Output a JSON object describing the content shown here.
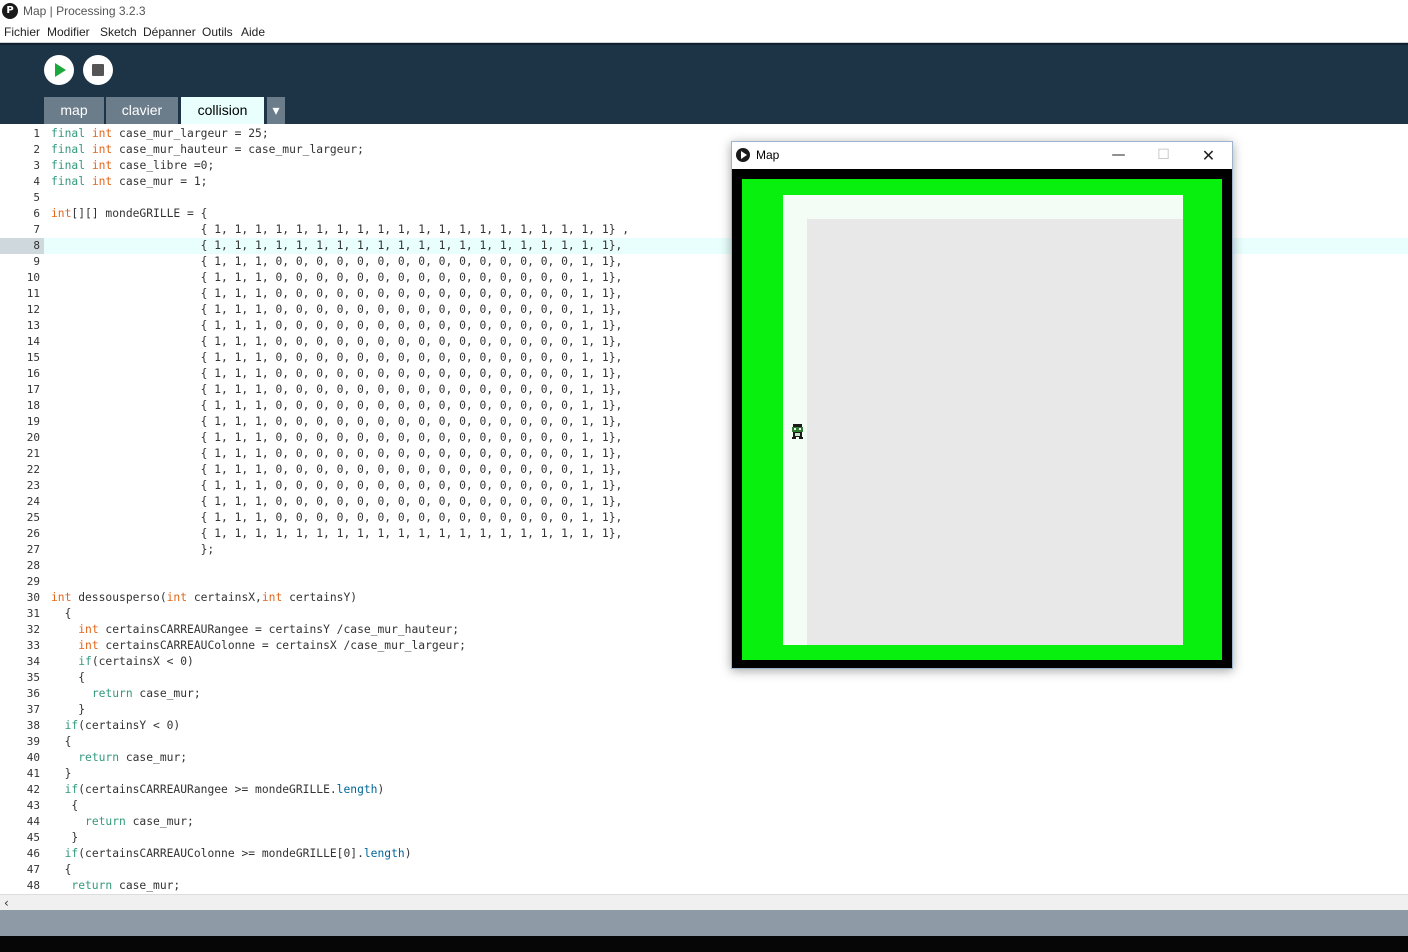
{
  "window": {
    "title": "Map | Processing 3.2.3",
    "app_icon": "P"
  },
  "menu": [
    "Fichier",
    "Modifier",
    "Sketch",
    "Dépanner",
    "Outils",
    "Aide"
  ],
  "tabs": [
    {
      "label": "map"
    },
    {
      "label": "clavier"
    },
    {
      "label": "collision",
      "active": true
    }
  ],
  "tab_dropdown": "▾",
  "editor": {
    "current_line": 8,
    "lines": [
      "final int case_mur_largeur = 25;",
      "final int case_mur_hauteur = case_mur_largeur;",
      "final int case_libre =0;",
      "final int case_mur = 1;",
      "",
      "int[][] mondeGRILLE = {",
      "                      { 1, 1, 1, 1, 1, 1, 1, 1, 1, 1, 1, 1, 1, 1, 1, 1, 1, 1, 1, 1} ,",
      "                      { 1, 1, 1, 1, 1, 1, 1, 1, 1, 1, 1, 1, 1, 1, 1, 1, 1, 1, 1, 1},",
      "                      { 1, 1, 1, 0, 0, 0, 0, 0, 0, 0, 0, 0, 0, 0, 0, 0, 0, 0, 1, 1},",
      "                      { 1, 1, 1, 0, 0, 0, 0, 0, 0, 0, 0, 0, 0, 0, 0, 0, 0, 0, 1, 1},",
      "                      { 1, 1, 1, 0, 0, 0, 0, 0, 0, 0, 0, 0, 0, 0, 0, 0, 0, 0, 1, 1},",
      "                      { 1, 1, 1, 0, 0, 0, 0, 0, 0, 0, 0, 0, 0, 0, 0, 0, 0, 0, 1, 1},",
      "                      { 1, 1, 1, 0, 0, 0, 0, 0, 0, 0, 0, 0, 0, 0, 0, 0, 0, 0, 1, 1},",
      "                      { 1, 1, 1, 0, 0, 0, 0, 0, 0, 0, 0, 0, 0, 0, 0, 0, 0, 0, 1, 1},",
      "                      { 1, 1, 1, 0, 0, 0, 0, 0, 0, 0, 0, 0, 0, 0, 0, 0, 0, 0, 1, 1},",
      "                      { 1, 1, 1, 0, 0, 0, 0, 0, 0, 0, 0, 0, 0, 0, 0, 0, 0, 0, 1, 1},",
      "                      { 1, 1, 1, 0, 0, 0, 0, 0, 0, 0, 0, 0, 0, 0, 0, 0, 0, 0, 1, 1},",
      "                      { 1, 1, 1, 0, 0, 0, 0, 0, 0, 0, 0, 0, 0, 0, 0, 0, 0, 0, 1, 1},",
      "                      { 1, 1, 1, 0, 0, 0, 0, 0, 0, 0, 0, 0, 0, 0, 0, 0, 0, 0, 1, 1},",
      "                      { 1, 1, 1, 0, 0, 0, 0, 0, 0, 0, 0, 0, 0, 0, 0, 0, 0, 0, 1, 1},",
      "                      { 1, 1, 1, 0, 0, 0, 0, 0, 0, 0, 0, 0, 0, 0, 0, 0, 0, 0, 1, 1},",
      "                      { 1, 1, 1, 0, 0, 0, 0, 0, 0, 0, 0, 0, 0, 0, 0, 0, 0, 0, 1, 1},",
      "                      { 1, 1, 1, 0, 0, 0, 0, 0, 0, 0, 0, 0, 0, 0, 0, 0, 0, 0, 1, 1},",
      "                      { 1, 1, 1, 0, 0, 0, 0, 0, 0, 0, 0, 0, 0, 0, 0, 0, 0, 0, 1, 1},",
      "                      { 1, 1, 1, 0, 0, 0, 0, 0, 0, 0, 0, 0, 0, 0, 0, 0, 0, 0, 1, 1},",
      "                      { 1, 1, 1, 1, 1, 1, 1, 1, 1, 1, 1, 1, 1, 1, 1, 1, 1, 1, 1, 1},",
      "                      };",
      "",
      "",
      "int dessousperso(int certainsX,int certainsY)",
      "  {",
      "    int certainsCARREAURangee = certainsY /case_mur_hauteur;",
      "    int certainsCARREAUColonne = certainsX /case_mur_largeur;",
      "    if(certainsX < 0)",
      "    {",
      "      return case_mur;",
      "    }",
      "  if(certainsY < 0)",
      "  {",
      "    return case_mur;",
      "  }",
      "  if(certainsCARREAURangee >= mondeGRILLE.length)",
      "   {",
      "     return case_mur;",
      "   }",
      "  if(certainsCARREAUColonne >= mondeGRILLE[0].length)",
      "  {",
      "   return case_mur;"
    ]
  },
  "scroll_left_glyph": "‹",
  "sketch_window": {
    "title": "Map",
    "minimize": "—",
    "maximize": "☐",
    "close": "✕",
    "colors": {
      "wall": "#08f00d",
      "border": "#000000",
      "floor_light": "#f3fcf5",
      "floor": "#e8e8e8"
    }
  }
}
